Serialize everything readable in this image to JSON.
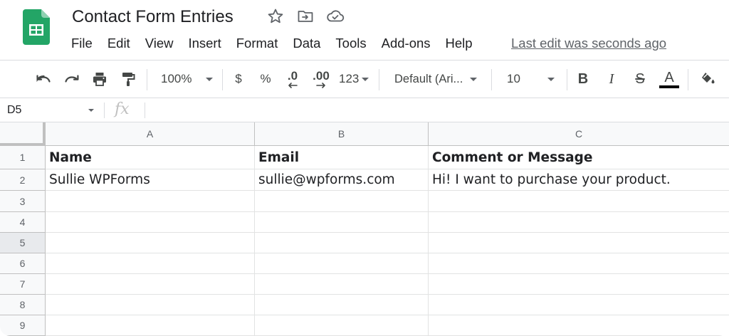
{
  "header": {
    "doc_title": "Contact Form Entries",
    "title_icons": [
      "star-icon",
      "move-to-folder-icon",
      "cloud-status-icon"
    ],
    "menu": [
      "File",
      "Edit",
      "View",
      "Insert",
      "Format",
      "Data",
      "Tools",
      "Add-ons",
      "Help"
    ],
    "last_edit": "Last edit was seconds ago"
  },
  "toolbar": {
    "zoom": "100%",
    "currency": "$",
    "percent": "%",
    "decrease_decimal": ".0",
    "increase_decimal": ".00",
    "more_formats": "123",
    "font": "Default (Ari...",
    "font_size": "10",
    "bold": "B",
    "italic": "I",
    "strikethrough": "S",
    "text_color": "A",
    "icons": [
      "undo-icon",
      "redo-icon",
      "print-icon",
      "paint-format-icon",
      "bold-icon",
      "italic-icon",
      "strikethrough-icon",
      "text-color-icon",
      "fill-color-icon"
    ]
  },
  "formula_bar": {
    "name_box": "D5",
    "fx": "fx",
    "content": ""
  },
  "grid": {
    "columns": [
      "A",
      "B",
      "C"
    ],
    "rows": [
      "1",
      "2",
      "3",
      "4",
      "5",
      "6",
      "7",
      "8",
      "9"
    ],
    "selected_row": "5",
    "cells": [
      [
        "Name",
        "Email",
        "Comment or Message"
      ],
      [
        "Sullie WPForms",
        "sullie@wpforms.com",
        "Hi! I want to purchase your product."
      ],
      [
        "",
        "",
        ""
      ],
      [
        "",
        "",
        ""
      ],
      [
        "",
        "",
        ""
      ],
      [
        "",
        "",
        ""
      ],
      [
        "",
        "",
        ""
      ],
      [
        "",
        "",
        ""
      ],
      [
        "",
        "",
        ""
      ]
    ],
    "bold_rows": [
      0
    ]
  },
  "colors": {
    "sheets_green": "#23a566",
    "grid_line": "#e2e3e3",
    "header_bg": "#f8f9fa",
    "text": "#202124"
  }
}
